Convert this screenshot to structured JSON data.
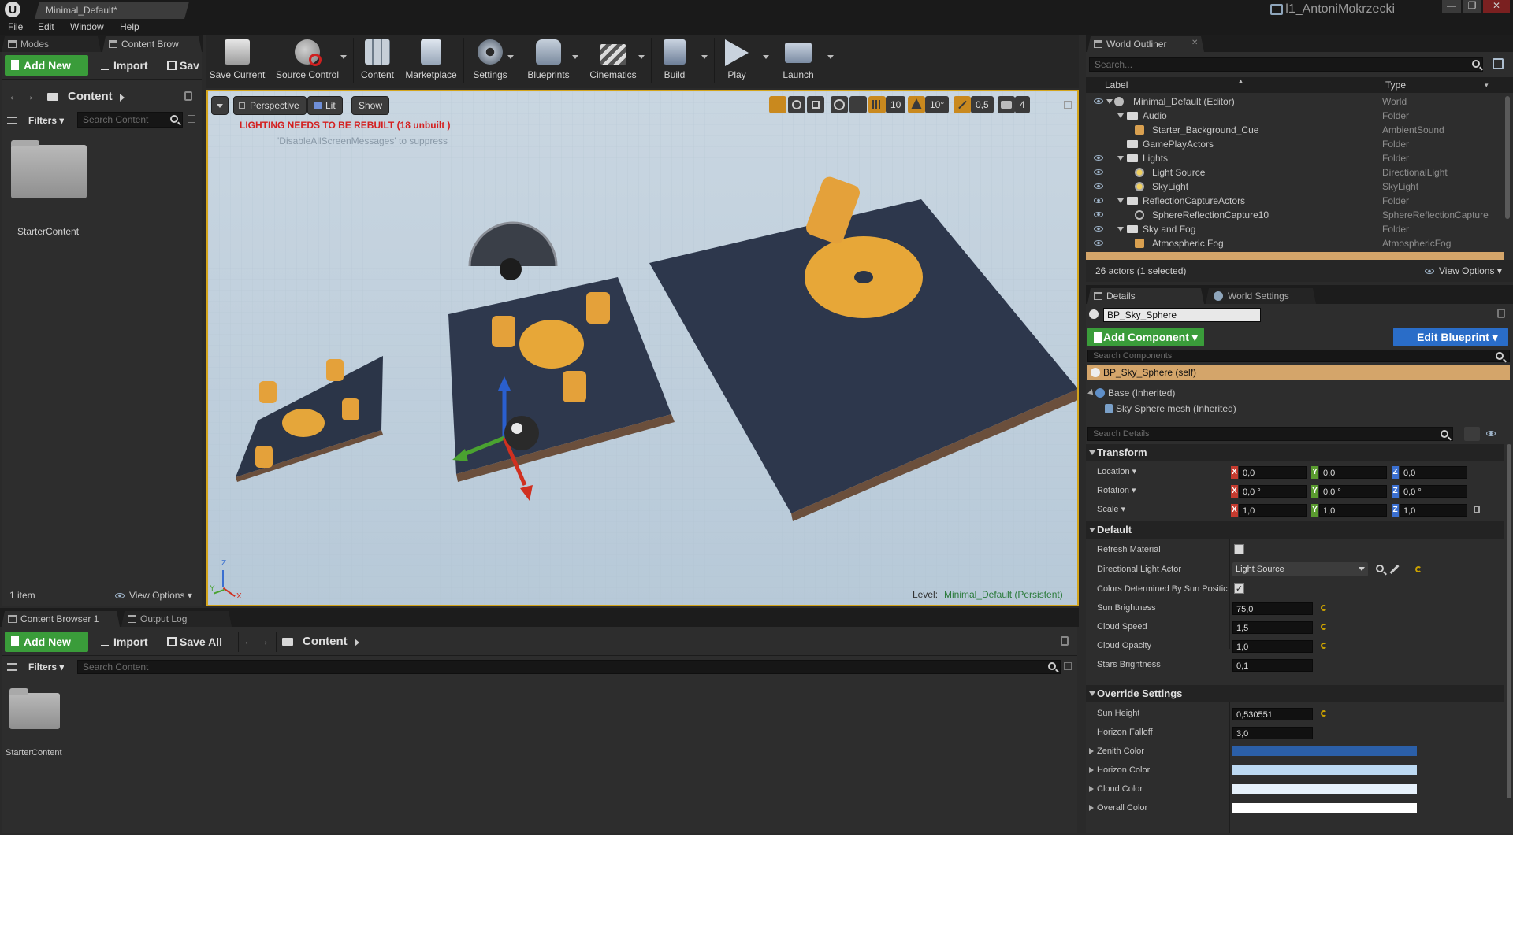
{
  "window": {
    "tab_title": "Minimal_Default*",
    "user": "l1_AntoniMokrzecki",
    "controls": {
      "minimize": "—",
      "restore": "❐",
      "close": "✕"
    }
  },
  "menu": [
    "File",
    "Edit",
    "Window",
    "Help"
  ],
  "left_panel": {
    "tabs": [
      "Modes",
      "Content Brow"
    ],
    "add_new": "Add New",
    "import": "Import",
    "save": "Sav",
    "path": "Content",
    "filters": "Filters",
    "search_placeholder": "Search Content",
    "folder_name": "StarterContent",
    "item_count": "1 item",
    "view_options": "View Options"
  },
  "toolbar": {
    "buttons": [
      "Save Current",
      "Source Control",
      "Content",
      "Marketplace",
      "Settings",
      "Blueprints",
      "Cinematics",
      "Build",
      "Play",
      "Launch"
    ]
  },
  "viewport": {
    "perspective": "Perspective",
    "lit": "Lit",
    "show": "Show",
    "warning": "LIGHTING NEEDS TO BE REBUILT (18 unbuilt )",
    "hint": "'DisableAllScreenMessages' to suppress",
    "grid_size": "10",
    "rotation_snap": "10°",
    "scale_snap": "0,5",
    "camera_speed": "4",
    "level_label": "Level:",
    "level_name": "Minimal_Default (Persistent)",
    "axis_labels": {
      "x": "X",
      "y": "Y",
      "z": "Z"
    }
  },
  "bottom_panel": {
    "tabs": [
      "Content Browser 1",
      "Output Log"
    ],
    "add_new": "Add New",
    "import": "Import",
    "save_all": "Save All",
    "path": "Content",
    "filters": "Filters",
    "search_placeholder": "Search Content",
    "folder_name": "StarterContent"
  },
  "outliner": {
    "tab": "World Outliner",
    "search_placeholder": "Search...",
    "col_label": "Label",
    "col_type": "Type",
    "rows": [
      {
        "label": "Minimal_Default (Editor)",
        "type": "World"
      },
      {
        "label": "Audio",
        "type": "Folder"
      },
      {
        "label": "Starter_Background_Cue",
        "type": "AmbientSound"
      },
      {
        "label": "GamePlayActors",
        "type": "Folder"
      },
      {
        "label": "Lights",
        "type": "Folder"
      },
      {
        "label": "Light Source",
        "type": "DirectionalLight"
      },
      {
        "label": "SkyLight",
        "type": "SkyLight"
      },
      {
        "label": "ReflectionCaptureActors",
        "type": "Folder"
      },
      {
        "label": "SphereReflectionCapture10",
        "type": "SphereReflectionCapture"
      },
      {
        "label": "Sky and Fog",
        "type": "Folder"
      },
      {
        "label": "Atmospheric Fog",
        "type": "AtmosphericFog"
      }
    ],
    "actor_count": "26 actors (1 selected)",
    "view_options": "View Options"
  },
  "details": {
    "tabs": [
      "Details",
      "World Settings"
    ],
    "object_name": "BP_Sky_Sphere",
    "add_component": "Add Component",
    "edit_blueprint": "Edit Blueprint",
    "search_components": "Search Components",
    "components": [
      "BP_Sky_Sphere (self)",
      "Base (Inherited)",
      "Sky Sphere mesh (Inherited)"
    ],
    "search_details": "Search Details",
    "transform": {
      "header": "Transform",
      "location": {
        "label": "Location",
        "x": "0,0",
        "y": "0,0",
        "z": "0,0"
      },
      "rotation": {
        "label": "Rotation",
        "x": "0,0 °",
        "y": "0,0 °",
        "z": "0,0 °"
      },
      "scale": {
        "label": "Scale",
        "x": "1,0",
        "y": "1,0",
        "z": "1,0"
      }
    },
    "default": {
      "header": "Default",
      "refresh_material": "Refresh Material",
      "directional_light_actor": "Directional Light Actor",
      "directional_light_value": "Light Source",
      "colors_by_sun": "Colors Determined By Sun Positic",
      "sun_brightness": {
        "label": "Sun Brightness",
        "value": "75,0"
      },
      "cloud_speed": {
        "label": "Cloud Speed",
        "value": "1,5"
      },
      "cloud_opacity": {
        "label": "Cloud Opacity",
        "value": "1,0"
      },
      "stars_brightness": {
        "label": "Stars Brightness",
        "value": "0,1"
      }
    },
    "override": {
      "header": "Override Settings",
      "sun_height": {
        "label": "Sun Height",
        "value": "0,530551"
      },
      "horizon_falloff": {
        "label": "Horizon Falloff",
        "value": "3,0"
      },
      "zenith_color": {
        "label": "Zenith Color",
        "color": "#2b5fa8"
      },
      "horizon_color": {
        "label": "Horizon Color",
        "color": "#bcd9f2"
      },
      "cloud_color": {
        "label": "Cloud Color",
        "color": "#e6f1fb"
      },
      "overall_color": {
        "label": "Overall Color",
        "color": "#ffffff"
      }
    }
  },
  "colors": {
    "green_button": "#3a9c3a",
    "blue_button": "#2a6dc8",
    "viewport_border": "#d4a51c",
    "warning_red": "#d42020",
    "selected_row": "#d4a56a"
  }
}
